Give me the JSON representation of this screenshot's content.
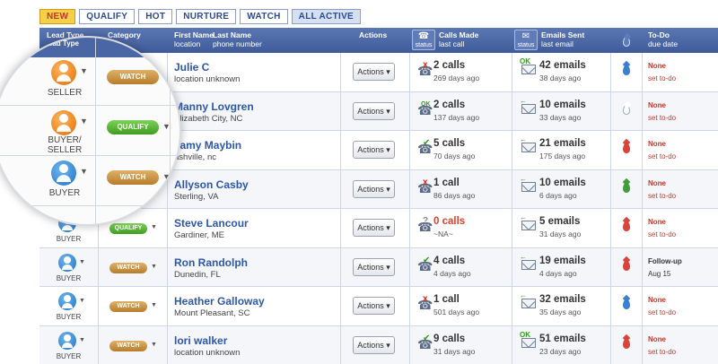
{
  "tabs": [
    {
      "label": "NEW"
    },
    {
      "label": "QUALIFY"
    },
    {
      "label": "HOT"
    },
    {
      "label": "NURTURE"
    },
    {
      "label": "WATCH"
    },
    {
      "label": "ALL ACTIVE"
    }
  ],
  "header": {
    "lead_type": "Lead Type",
    "category": "Category",
    "first_name": "First Name",
    "last_name": "Last Name",
    "location": "location",
    "phone": "phone number",
    "actions": "Actions",
    "calls_made": "Calls Made",
    "last_call": "last call",
    "emails_sent": "Emails Sent",
    "last_email": "last email",
    "status": "status",
    "todo": "To-Do",
    "due_date": "due date"
  },
  "colors": {
    "header_bg": "#4a66a5",
    "link": "#2d57a8",
    "watch": "#c8913f",
    "qualify": "#52b030",
    "alert": "#c0392b"
  },
  "lens": {
    "rows": [
      {
        "type": "SELLER",
        "category": "WATCH",
        "avatar": "orange"
      },
      {
        "type": "BUYER/\nSELLER",
        "category": "QUALIFY",
        "avatar": "orange"
      },
      {
        "type": "BUYER",
        "category": "WATCH",
        "avatar": "blue"
      }
    ]
  },
  "leads": [
    {
      "type": "SELLER",
      "avatar": "orange",
      "category": "WATCH",
      "name": "Julie C",
      "location": "location unknown",
      "actions": "Actions",
      "call_mark": "x",
      "calls": "2 calls",
      "calls_red": false,
      "call_ago": "269 days ago",
      "email_mark": "OK",
      "emails": "42 emails",
      "email_ago": "38 days ago",
      "drop": "blue",
      "todo": "None",
      "todo_sub": "set to-do",
      "todo_dark": false
    },
    {
      "type": "BUYER/SELLER",
      "avatar": "orange",
      "category": "QUALIFY",
      "name": "Manny Lovgren",
      "location": "Elizabeth City, NC",
      "actions": "Actions",
      "call_mark": "OK",
      "calls": "2 calls",
      "calls_red": false,
      "call_ago": "137 days ago",
      "email_mark": "←",
      "emails": "10 emails",
      "email_ago": "33 days ago",
      "drop": "empty",
      "todo": "None",
      "todo_sub": "set to-do",
      "todo_dark": false
    },
    {
      "type": "BUYER",
      "avatar": "blue",
      "category": "WATCH",
      "name": "Tamy Maybin",
      "location": "ashville, nc",
      "actions": "Actions",
      "call_mark": "✔",
      "calls": "5 calls",
      "calls_red": false,
      "call_ago": "70 days ago",
      "email_mark": "←",
      "emails": "21 emails",
      "email_ago": "175 days ago",
      "drop": "red",
      "todo": "None",
      "todo_sub": "set to-do",
      "todo_dark": false
    },
    {
      "type": "BUYER",
      "avatar": "blue",
      "category": "WATCH",
      "name": "Allyson Casby",
      "location": "Sterling, VA",
      "actions": "Actions",
      "call_mark": "x",
      "calls": "1 call",
      "calls_red": false,
      "call_ago": "86 days ago",
      "email_mark": "←",
      "emails": "10 emails",
      "email_ago": "6 days ago",
      "drop": "green",
      "todo": "None",
      "todo_sub": "set to-do",
      "todo_dark": false
    },
    {
      "type": "BUYER",
      "avatar": "blue",
      "category": "QUALIFY",
      "name": "Steve Lancour",
      "location": "Gardiner, ME",
      "actions": "Actions",
      "call_mark": "?",
      "calls": "0 calls",
      "calls_red": true,
      "call_ago": "~NA~",
      "email_mark": "←",
      "emails": "5 emails",
      "email_ago": "31 days ago",
      "drop": "red",
      "todo": "None",
      "todo_sub": "set to-do",
      "todo_dark": false
    },
    {
      "type": "BUYER",
      "avatar": "blue",
      "category": "WATCH",
      "name": "Ron Randolph",
      "location": "Dunedin, FL",
      "actions": "Actions",
      "call_mark": "✔",
      "calls": "4 calls",
      "calls_red": false,
      "call_ago": "4 days ago",
      "email_mark": "←",
      "emails": "19 emails",
      "email_ago": "4 days ago",
      "drop": "red",
      "todo": "Follow-up",
      "todo_sub": "Aug 15",
      "todo_dark": true
    },
    {
      "type": "BUYER",
      "avatar": "blue",
      "category": "WATCH",
      "name": "Heather Galloway",
      "location": "Mount Pleasant, SC",
      "actions": "Actions",
      "call_mark": "x",
      "calls": "1 call",
      "calls_red": false,
      "call_ago": "501 days ago",
      "email_mark": "←",
      "emails": "32 emails",
      "email_ago": "35 days ago",
      "drop": "blue",
      "todo": "None",
      "todo_sub": "set to-do",
      "todo_dark": false
    },
    {
      "type": "BUYER",
      "avatar": "blue",
      "category": "WATCH",
      "name": "lori walker",
      "location": "location unknown",
      "actions": "Actions",
      "call_mark": "✔",
      "calls": "9 calls",
      "calls_red": false,
      "call_ago": "31 days ago",
      "email_mark": "OK",
      "emails": "51 emails",
      "email_ago": "23 days ago",
      "drop": "red",
      "todo": "None",
      "todo_sub": "set to-do",
      "todo_dark": false
    }
  ]
}
